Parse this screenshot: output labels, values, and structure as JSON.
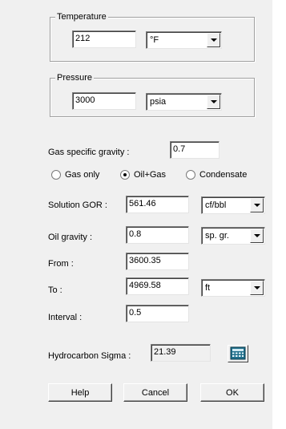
{
  "temperature": {
    "legend": "Temperature",
    "value": "212",
    "unit": "°F"
  },
  "pressure": {
    "legend": "Pressure",
    "value": "3000",
    "unit": "psia"
  },
  "gas_specific_gravity": {
    "label": "Gas specific gravity :",
    "value": "0.7"
  },
  "fluid_type": {
    "options": [
      "Gas only",
      "Oil+Gas",
      "Condensate"
    ],
    "selected": "Oil+Gas"
  },
  "solution_gor": {
    "label": "Solution GOR :",
    "value": "561.46",
    "unit": "cf/bbl"
  },
  "oil_gravity": {
    "label": "Oil gravity :",
    "value": "0.8",
    "unit": "sp. gr."
  },
  "from": {
    "label": "From :",
    "value": "3600.35"
  },
  "to": {
    "label": "To :",
    "value": "4969.58",
    "unit": "ft"
  },
  "interval": {
    "label": "Interval :",
    "value": "0.5"
  },
  "hydrocarbon_sigma": {
    "label": "Hydrocarbon Sigma :",
    "value": "21.39",
    "button_icon": "calculator-icon"
  },
  "buttons": {
    "help": "Help",
    "cancel": "Cancel",
    "ok": "OK"
  },
  "colors": {
    "dialog_bg": "#f0f0f0",
    "calc_icon": "#1f6f8b"
  }
}
